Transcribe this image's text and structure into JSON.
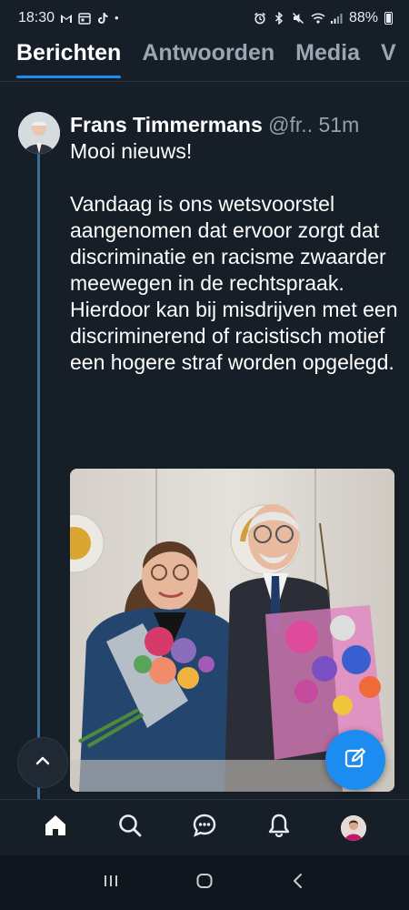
{
  "status_bar": {
    "time": "18:30",
    "battery": "88%",
    "indicator_dot": "•"
  },
  "tabs": [
    {
      "label": "Berichten",
      "active": true
    },
    {
      "label": "Antwoorden",
      "active": false
    },
    {
      "label": "Media",
      "active": false
    },
    {
      "label": "V",
      "active": false
    }
  ],
  "post": {
    "author_name": "Frans Timmermans",
    "author_handle": "@fr..",
    "time": "51m",
    "text": "Mooi nieuws!\n\nVandaag is ons wetsvoorstel aangenomen dat ervoor zorgt dat discriminatie en racisme zwaarder meewegen in de rechtspraak. Hierdoor kan bij misdrijven met een discriminerend of racistisch motief een hogere straf worden opgelegd."
  },
  "colors": {
    "background": "#161e27",
    "accent": "#1d8cf0",
    "muted_text": "#93a0ad",
    "thread_line": "#3a6f9a"
  },
  "icons": {
    "status_left": [
      "gmail-icon",
      "calendar-icon",
      "tiktok-icon"
    ],
    "status_right": [
      "alarm-icon",
      "bluetooth-icon",
      "mute-icon",
      "wifi-icon",
      "signal-icon",
      "battery-icon"
    ],
    "bottom_nav": [
      "home-icon",
      "search-icon",
      "chat-icon",
      "bell-icon",
      "profile-avatar"
    ],
    "system_nav": [
      "recents-icon",
      "home-button-icon",
      "back-icon"
    ]
  }
}
